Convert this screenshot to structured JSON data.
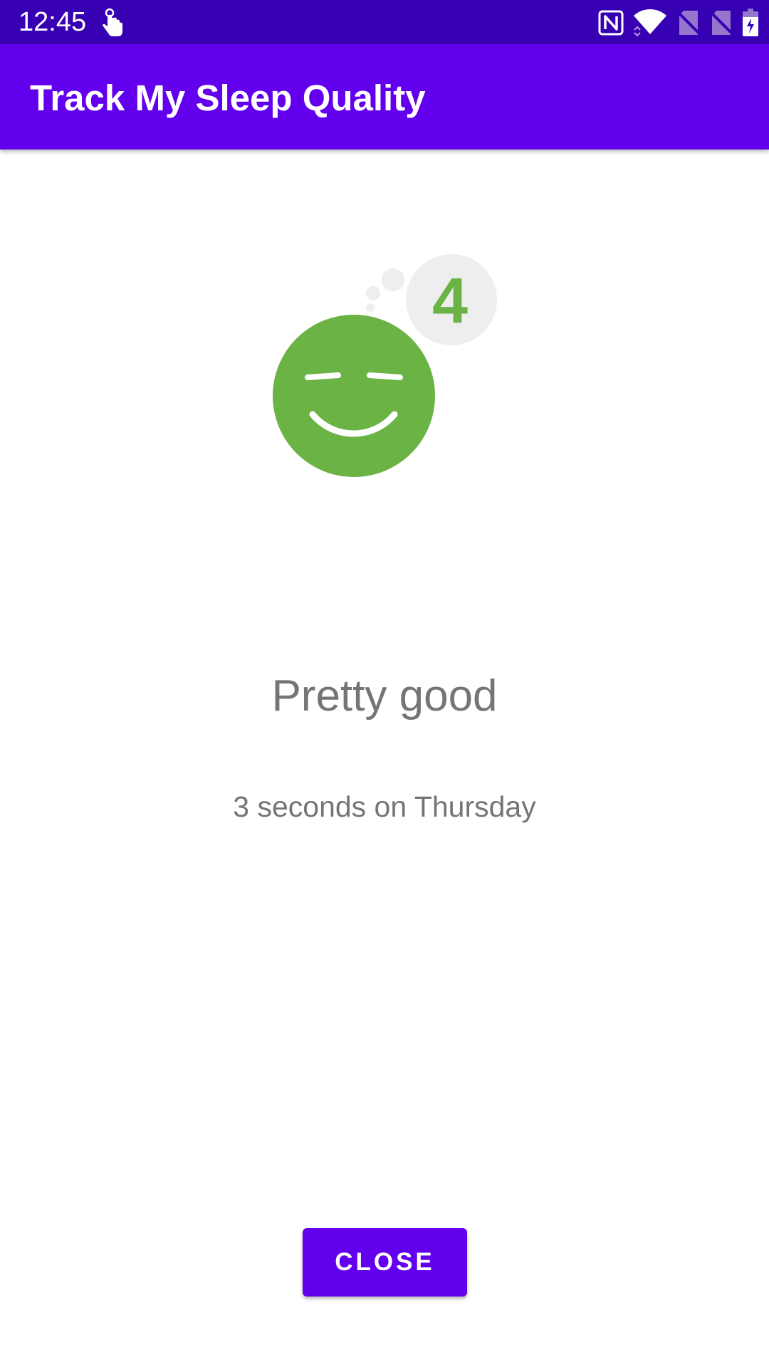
{
  "status_bar": {
    "time": "12:45",
    "icons": [
      "touch-icon",
      "nfc-icon",
      "wifi-icon",
      "no-sim-icon",
      "no-sim-icon",
      "battery-charging-icon"
    ]
  },
  "app_bar": {
    "title": "Track My Sleep Quality"
  },
  "quality": {
    "rating": "4",
    "label": "Pretty good",
    "icon": "smiling-face-icon",
    "color": "#6ab344"
  },
  "duration_label": "3 seconds on Thursday",
  "close_button_label": "CLOSE",
  "colors": {
    "primary": "#6200ee",
    "primary_dark": "#3700b3",
    "text_secondary": "#757575"
  }
}
